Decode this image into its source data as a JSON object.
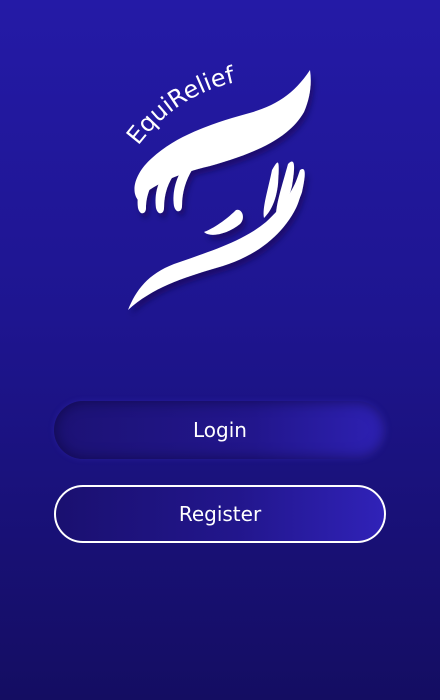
{
  "app": {
    "brand_name": "EquiRelief"
  },
  "colors": {
    "background_top": "#241aa6",
    "background_bottom": "#140d62",
    "button_text": "#ffffff",
    "logo": "#ffffff"
  },
  "icons": {
    "logo": "two-hands-icon"
  },
  "actions": {
    "login_label": "Login",
    "register_label": "Register"
  }
}
